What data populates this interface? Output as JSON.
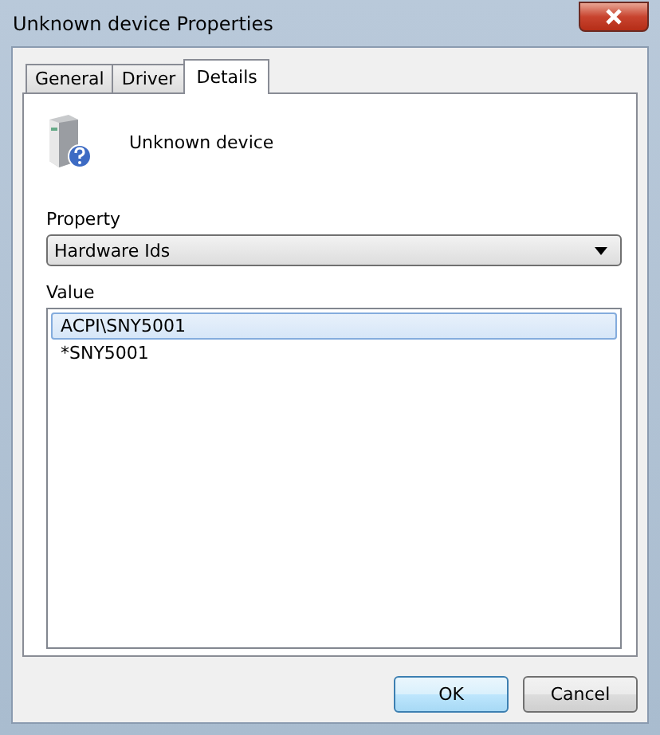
{
  "window": {
    "title": "Unknown device Properties"
  },
  "tabs": [
    {
      "label": "General",
      "selected": false
    },
    {
      "label": "Driver",
      "selected": false
    },
    {
      "label": "Details",
      "selected": true
    }
  ],
  "device": {
    "name": "Unknown device"
  },
  "property": {
    "label": "Property",
    "value": "Hardware Ids"
  },
  "value_list": {
    "label": "Value",
    "items": [
      {
        "text": "ACPI\\SNY5001",
        "selected": true
      },
      {
        "text": "*SNY5001",
        "selected": false
      }
    ]
  },
  "buttons": [
    {
      "label": "OK",
      "default": true
    },
    {
      "label": "Cancel",
      "default": false
    }
  ]
}
